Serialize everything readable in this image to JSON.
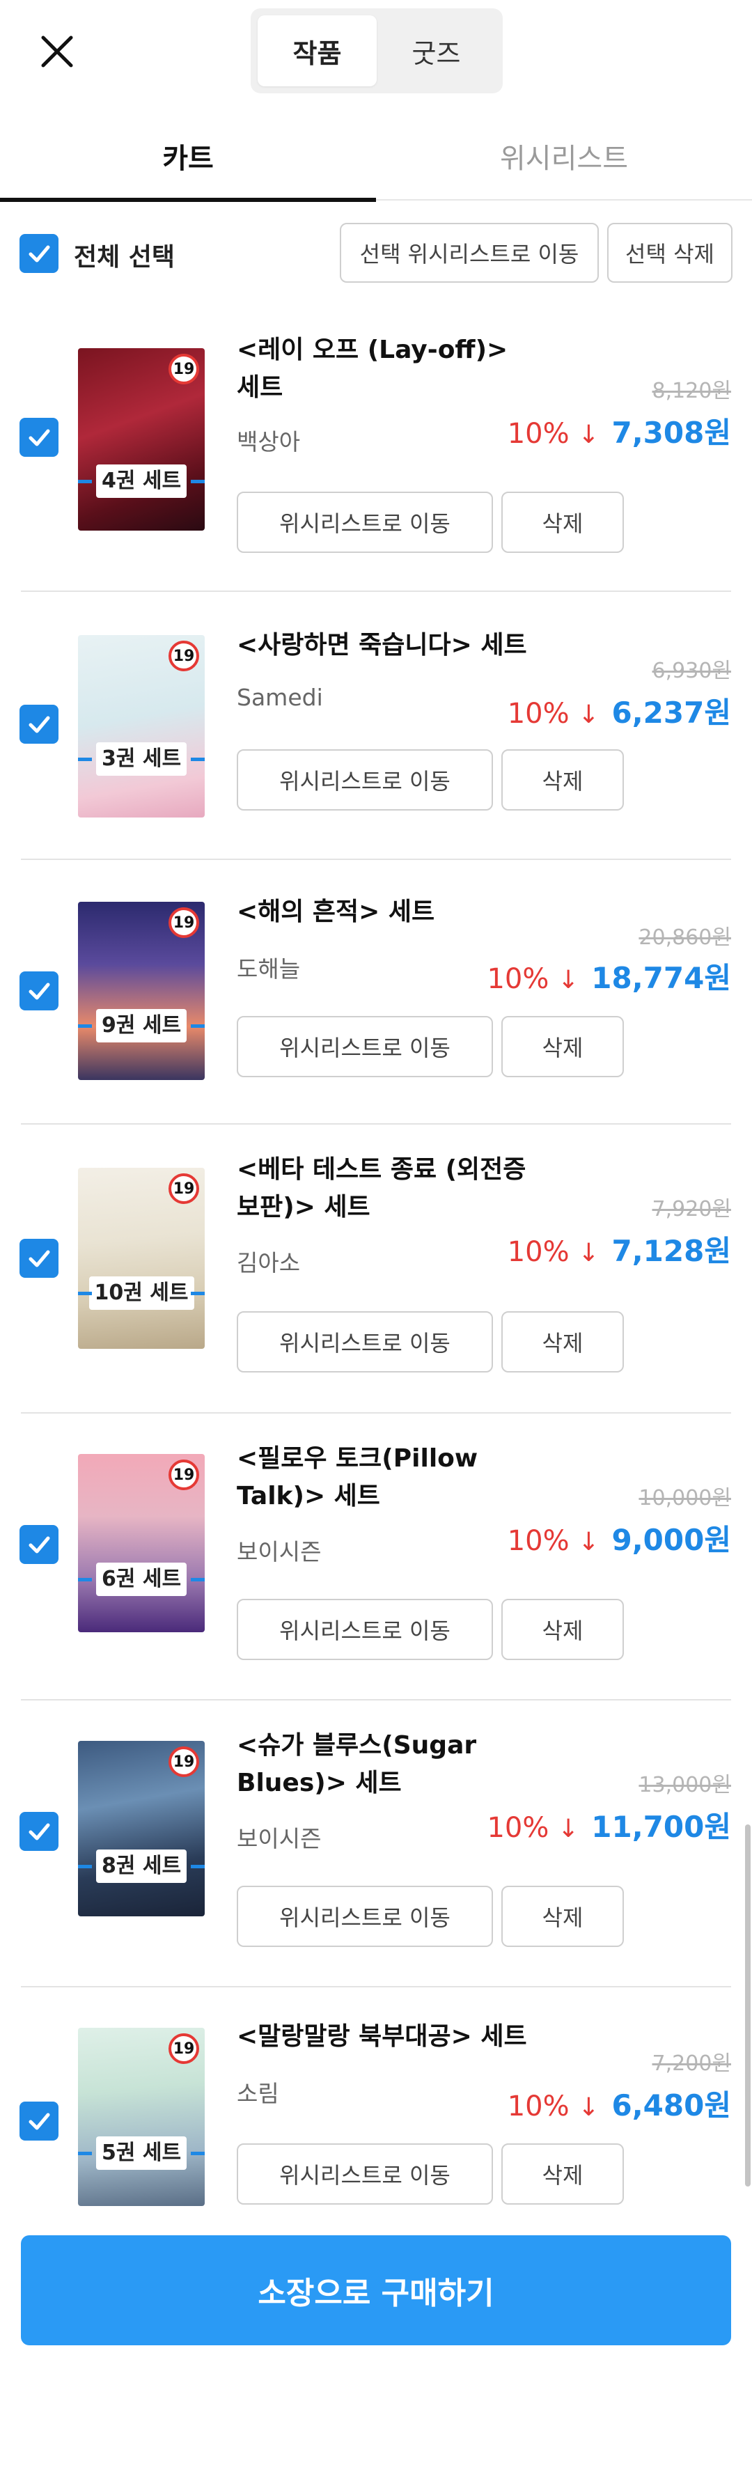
{
  "segment": {
    "works": "작품",
    "goods": "굿즈"
  },
  "tabs": {
    "cart": "카트",
    "wishlist": "위시리스트"
  },
  "select_all": {
    "label": "전체 선택",
    "checked": true
  },
  "actions": {
    "move_selected": "선택 위시리스트로 이동",
    "delete_selected": "선택 삭제"
  },
  "item_actions": {
    "move": "위시리스트로 이동",
    "delete": "삭제"
  },
  "age_rating": "19",
  "items": [
    {
      "title": "<레이 오프 (Lay-off)> 세트",
      "author": "백상아",
      "set": "4권 세트",
      "original_price": "8,120원",
      "discount": "10%",
      "price": "7,308원",
      "checked": true
    },
    {
      "title": "<사랑하면 죽습니다> 세트",
      "author": "Samedi",
      "set": "3권 세트",
      "original_price": "6,930원",
      "discount": "10%",
      "price": "6,237원",
      "checked": true
    },
    {
      "title": "<해의 흔적> 세트",
      "author": "도해늘",
      "set": "9권 세트",
      "original_price": "20,860원",
      "discount": "10%",
      "price": "18,774원",
      "checked": true
    },
    {
      "title": "<베타 테스트 종료 (외전증보판)> 세트",
      "author": "김아소",
      "set": "10권 세트",
      "original_price": "7,920원",
      "discount": "10%",
      "price": "7,128원",
      "checked": true
    },
    {
      "title": "<필로우 토크(Pillow Talk)> 세트",
      "author": "보이시즌",
      "set": "6권 세트",
      "original_price": "10,000원",
      "discount": "10%",
      "price": "9,000원",
      "checked": true
    },
    {
      "title": "<슈가 블루스(Sugar Blues)> 세트",
      "author": "보이시즌",
      "set": "8권 세트",
      "original_price": "13,000원",
      "discount": "10%",
      "price": "11,700원",
      "checked": true
    },
    {
      "title": "<말랑말랑 북부대공> 세트",
      "author": "소림",
      "set": "5권 세트",
      "original_price": "7,200원",
      "discount": "10%",
      "price": "6,480원",
      "checked": true
    }
  ],
  "purchase_button": "소장으로 구매하기",
  "colors": {
    "accent": "#1e88e5",
    "discount": "#e53935",
    "purchase": "#2a9af5"
  }
}
